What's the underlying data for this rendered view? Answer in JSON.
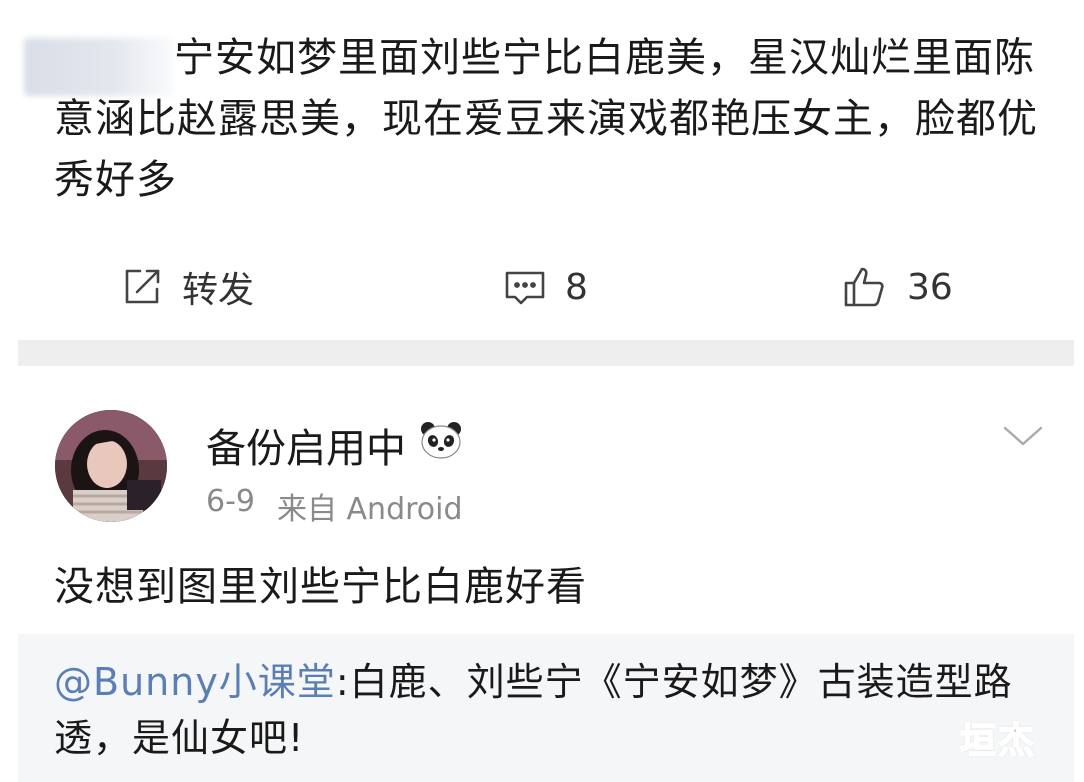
{
  "post1": {
    "text": "宁安如梦里面刘些宁比白鹿美，星汉灿烂里面陈意涵比赵露思美，现在爱豆来演戏都艳压女主，脸都优秀好多",
    "actions": {
      "repost_label": "转发",
      "comment_count": "8",
      "like_count": "36"
    }
  },
  "post2": {
    "username": "备份启用中",
    "date": "6-9",
    "source": "来自 Android",
    "text": "没想到图里刘些宁比白鹿好看",
    "quote": {
      "mention": "@Bunny小课堂",
      "text": ":白鹿、刘些宁《宁安如梦》古装造型路透，是仙女吧!"
    }
  },
  "watermark": "垣杰",
  "colors": {
    "mention": "#5b7fb4",
    "meta": "#8a8a8a",
    "divider": "#eeeeee"
  }
}
